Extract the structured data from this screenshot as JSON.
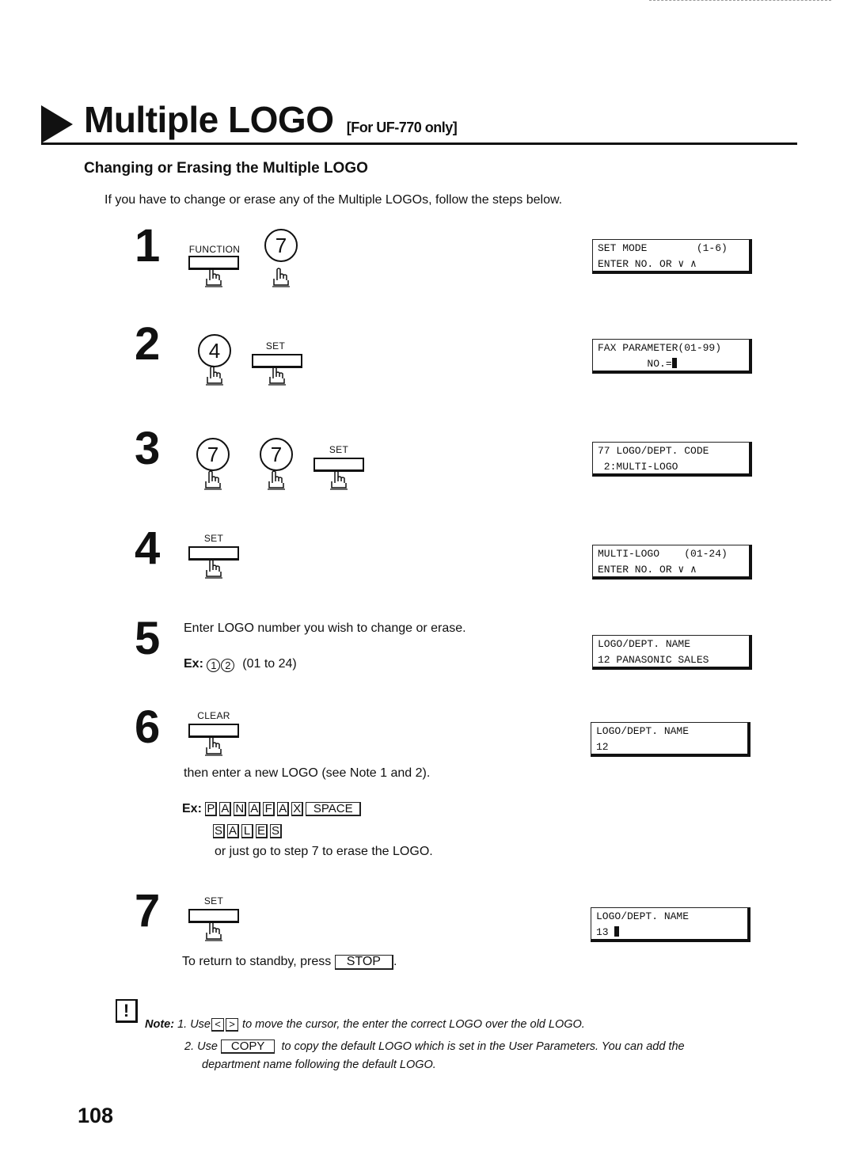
{
  "header": {
    "title": "Multiple LOGO",
    "subtitle": "[For UF-770 only]",
    "section_heading": "Changing or Erasing the Multiple LOGO",
    "intro": "If you have to change or erase any of the Multiple LOGOs, follow the steps below."
  },
  "steps": [
    {
      "number": "1",
      "keys": [
        {
          "type": "rect",
          "label": "FUNCTION"
        },
        {
          "type": "round",
          "label": "7"
        }
      ],
      "display": [
        "SET MODE        (1-6)",
        "ENTER NO. OR ∨ ∧"
      ]
    },
    {
      "number": "2",
      "keys": [
        {
          "type": "round",
          "label": "4"
        },
        {
          "type": "rect",
          "label": "SET"
        }
      ],
      "display": [
        "FAX PARAMETER(01-99)",
        "        NO.="
      ]
    },
    {
      "number": "3",
      "keys": [
        {
          "type": "round",
          "label": "7"
        },
        {
          "type": "round",
          "label": "7"
        },
        {
          "type": "rect",
          "label": "SET"
        }
      ],
      "display": [
        "77 LOGO/DEPT. CODE",
        " 2:MULTI-LOGO"
      ]
    },
    {
      "number": "4",
      "keys": [
        {
          "type": "rect",
          "label": "SET"
        }
      ],
      "display": [
        "MULTI-LOGO    (01-24)",
        "ENTER NO. OR ∨ ∧"
      ]
    },
    {
      "number": "5",
      "text": "Enter LOGO number you wish to change or erase.",
      "example_label": "Ex:",
      "example_digits": [
        "1",
        "2"
      ],
      "example_range": "(01 to 24)",
      "display": [
        "LOGO/DEPT. NAME",
        "12 PANASONIC SALES"
      ]
    },
    {
      "number": "6",
      "keys": [
        {
          "type": "rect",
          "label": "CLEAR"
        }
      ],
      "text": "then enter a new LOGO (see Note 1 and 2).",
      "example_label": "Ex:",
      "example_keys_line1": [
        "P",
        "A",
        "N",
        "A",
        "F",
        "A",
        "X",
        "SPACE"
      ],
      "example_keys_line2": [
        "S",
        "A",
        "L",
        "E",
        "S"
      ],
      "text2": "or just go to step 7 to erase the LOGO.",
      "display": [
        "LOGO/DEPT. NAME",
        "12"
      ]
    },
    {
      "number": "7",
      "keys": [
        {
          "type": "rect",
          "label": "SET"
        }
      ],
      "text_before": "To return to standby, press",
      "stop_key": "STOP",
      "text_after": ".",
      "display": [
        "LOGO/DEPT. NAME",
        "13 "
      ]
    }
  ],
  "note": {
    "label": "Note:",
    "icon": "exclamation-icon",
    "items": [
      {
        "prefix": "1. Use",
        "keys": [
          "<",
          ">"
        ],
        "text": "to move the cursor, the enter the correct LOGO over the old LOGO."
      },
      {
        "prefix": "2. Use",
        "keys": [
          "COPY"
        ],
        "text": "to copy the default LOGO which is set in the User Parameters.  You can add the",
        "text2": "department name following the default LOGO."
      }
    ]
  },
  "page_number": "108"
}
